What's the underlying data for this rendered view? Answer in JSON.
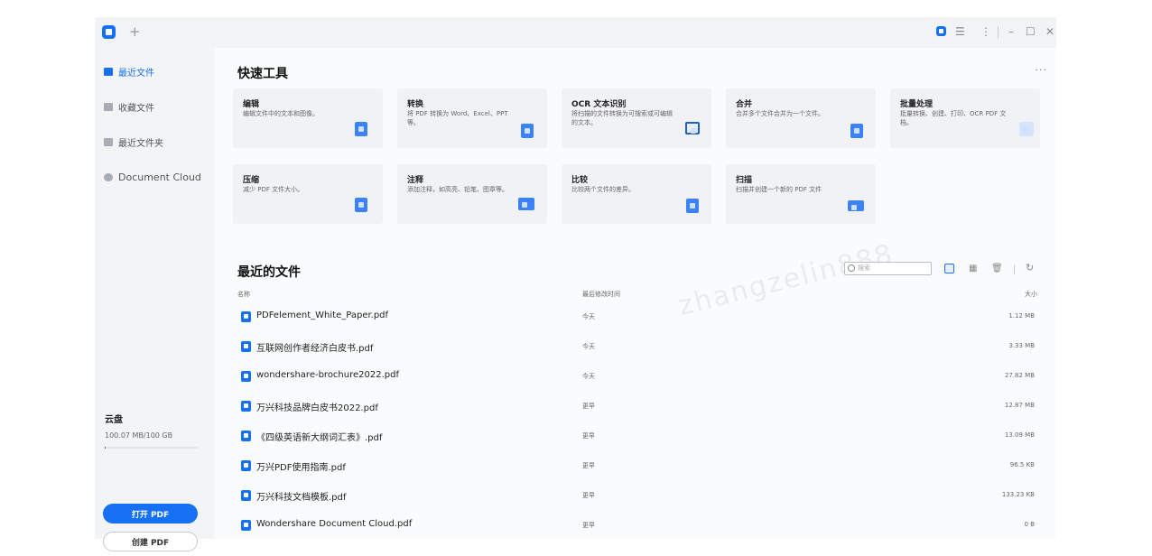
{
  "titlebar": {
    "new_tab": "+",
    "icons": [
      "app-logo-icon",
      "feedback-icon",
      "more-vertical-icon",
      "minimize-icon",
      "maximize-icon",
      "close-icon"
    ],
    "minimize": "–",
    "maximize": "☐",
    "close": "✕",
    "feedback": "☰",
    "more": "⋮"
  },
  "sidebar": {
    "items": [
      {
        "label": "最近文件",
        "icon": "recent-files-icon",
        "active": true
      },
      {
        "label": "收藏文件",
        "icon": "star-icon",
        "active": false
      },
      {
        "label": "最近文件夹",
        "icon": "folder-icon",
        "active": false
      },
      {
        "label": "Document Cloud",
        "icon": "cloud-icon",
        "active": false
      }
    ],
    "cloud": {
      "title": "云盘",
      "usage": "100.07 MB/100 GB",
      "used_fraction": 0.001
    },
    "open_pdf": "打开 PDF",
    "create_pdf": "创建 PDF"
  },
  "quick_tools": {
    "title": "快速工具",
    "more": "···",
    "cards": [
      {
        "title": "编辑",
        "desc": "编辑文件中的文本和图像。",
        "icon": "edit-icon"
      },
      {
        "title": "转换",
        "desc": "将 PDF 转换为 Word、Excel、PPT等。",
        "icon": "convert-icon"
      },
      {
        "title": "OCR 文本识别",
        "desc": "将扫描的文件转换为可搜索或可编辑的文本。",
        "icon": "ocr-icon"
      },
      {
        "title": "合并",
        "desc": "合并多个文件合并为一个文件。",
        "icon": "merge-icon"
      },
      {
        "title": "批量处理",
        "desc": "批量转换、创建、打印、OCR PDF 文档。",
        "icon": "batch-icon"
      },
      {
        "title": "压缩",
        "desc": "减少 PDF 文件大小。",
        "icon": "compress-icon"
      },
      {
        "title": "注释",
        "desc": "添加注释，如高亮、铅笔、图章等。",
        "icon": "comment-icon"
      },
      {
        "title": "比较",
        "desc": "比较两个文件的差异。",
        "icon": "compare-icon"
      },
      {
        "title": "扫描",
        "desc": "扫描并创建一个新的 PDF 文件",
        "icon": "scan-icon"
      }
    ]
  },
  "recent": {
    "title": "最近的文件",
    "search_placeholder": "搜索",
    "columns": {
      "name": "名称",
      "date": "最后修改时间",
      "size": "大小"
    },
    "files": [
      {
        "name": "PDFelement_White_Paper.pdf",
        "date": "今天",
        "size": "1.12 MB"
      },
      {
        "name": "互联网创作者经济白皮书.pdf",
        "date": "今天",
        "size": "3.33 MB"
      },
      {
        "name": "wondershare-brochure2022.pdf",
        "date": "今天",
        "size": "27.82 MB"
      },
      {
        "name": "万兴科技品牌白皮书2022.pdf",
        "date": "更早",
        "size": "12.87 MB"
      },
      {
        "name": "《四级英语新大纲词汇表》.pdf",
        "date": "更早",
        "size": "13.09 MB"
      },
      {
        "name": "万兴PDF使用指南.pdf",
        "date": "更早",
        "size": "96.5 KB"
      },
      {
        "name": "万兴科技文档模板.pdf",
        "date": "更早",
        "size": "133.23 KB"
      },
      {
        "name": "Wondershare Document Cloud.pdf",
        "date": "更早",
        "size": "0 B"
      }
    ]
  },
  "watermark": "zhangzelin888",
  "colors": {
    "accent": "#1670f3",
    "sidebar_bg": "#f3f4f6",
    "card_bg": "#f1f2f5"
  }
}
